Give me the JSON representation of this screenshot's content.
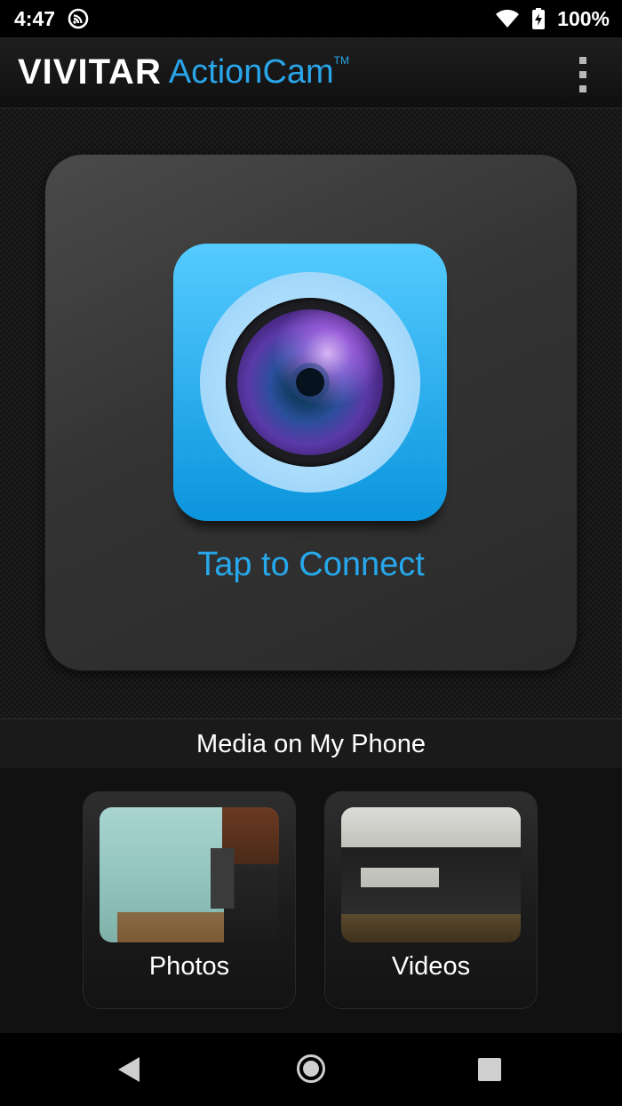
{
  "status": {
    "time": "4:47",
    "battery_text": "100%",
    "icons": [
      "cast-icon",
      "wifi-icon",
      "battery-charging-icon"
    ]
  },
  "appbar": {
    "brand": "VIVITAR",
    "product": "ActionCam",
    "trademark": "TM",
    "menu_icon": "overflow-menu-icon"
  },
  "connect": {
    "label": "Tap to Connect",
    "icon": "camera-lens-icon",
    "accent": "#27a8ec"
  },
  "media": {
    "header": "Media on My Phone",
    "tiles": [
      {
        "label": "Photos"
      },
      {
        "label": "Videos"
      }
    ]
  },
  "navbar": {
    "icons": [
      "back-icon",
      "home-icon",
      "recents-icon"
    ]
  }
}
